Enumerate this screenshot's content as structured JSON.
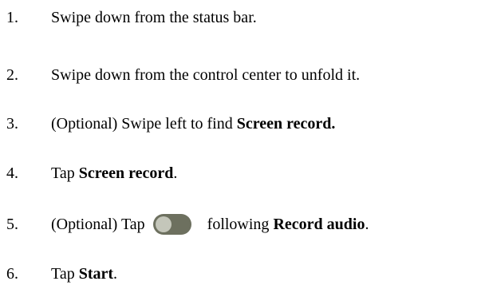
{
  "steps": [
    {
      "number": "1.",
      "text": "Swipe down from the status bar."
    },
    {
      "number": "2.",
      "text": "Swipe down from the control center to unfold it."
    },
    {
      "number": "3.",
      "pre": "(Optional) Swipe left to find ",
      "bold": "Screen record."
    },
    {
      "number": "4.",
      "pre": "Tap ",
      "bold": "Screen record",
      "post": "."
    },
    {
      "number": "5.",
      "pre": "(Optional) Tap",
      "post_toggle": "following ",
      "bold": "Record audio",
      "post": "."
    },
    {
      "number": "6.",
      "pre": "Tap ",
      "bold": "Start",
      "post": "."
    }
  ],
  "toggle": {
    "icon": "toggle-off-icon",
    "track_color": "#6d705f",
    "knob_color": "#c4c6ba"
  }
}
